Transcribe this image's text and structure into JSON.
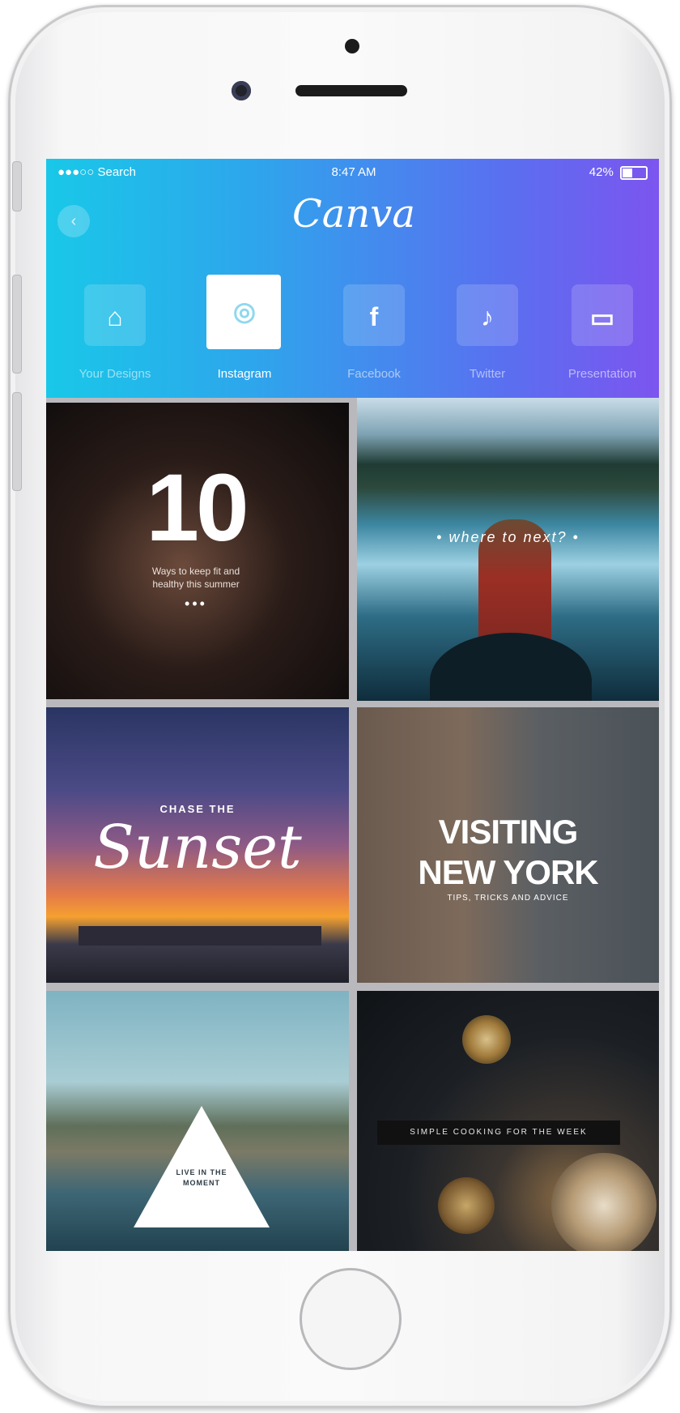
{
  "status_bar": {
    "carrier": "●●●○○ Search",
    "time": "8:47 AM",
    "battery": "42%"
  },
  "header": {
    "logo": "Canva"
  },
  "categories": [
    {
      "label": "Your Designs",
      "icon": "home-icon",
      "glyph": "⌂"
    },
    {
      "label": "Instagram",
      "icon": "instagram-icon",
      "glyph": "◎",
      "active": true
    },
    {
      "label": "Facebook",
      "icon": "facebook-icon",
      "glyph": "f"
    },
    {
      "label": "Twitter",
      "icon": "twitter-icon",
      "glyph": "♪"
    },
    {
      "label": "Presentation",
      "icon": "presentation-icon",
      "glyph": "▭"
    }
  ],
  "templates": {
    "t1": {
      "headline": "10",
      "subtitle": "Ways to keep fit and healthy this summer",
      "dots": "•••"
    },
    "t2": {
      "headline": "•  where to next?  •"
    },
    "t3": {
      "kicker": "CHASE THE",
      "headline": "Sunset"
    },
    "t4": {
      "line1": "VISITING",
      "line2": "NEW YORK",
      "subtitle": "TIPS, TRICKS AND ADVICE"
    },
    "t5": {
      "text": "LIVE IN THE MOMENT"
    },
    "t6": {
      "banner": "SIMPLE COOKING FOR THE WEEK"
    }
  },
  "colors": {
    "header_start": "#19c8e8",
    "header_end": "#7c55ef"
  }
}
